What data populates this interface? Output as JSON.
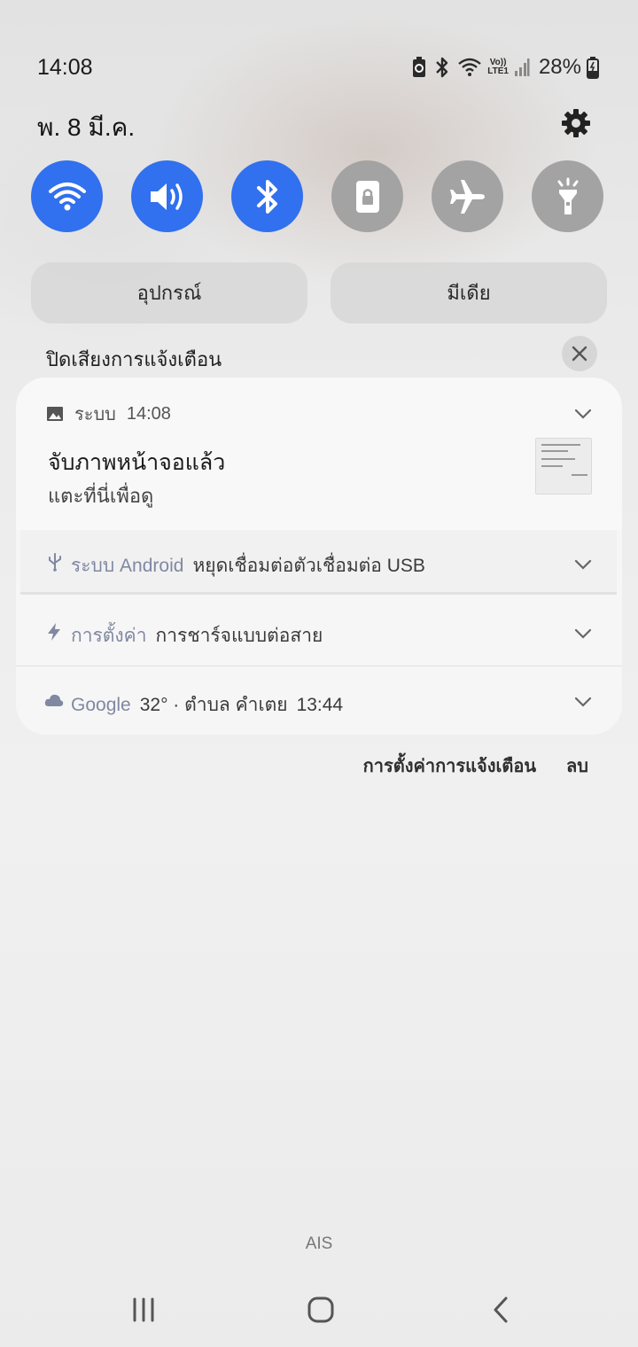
{
  "status": {
    "time": "14:08",
    "battery": "28%",
    "icons": [
      "battery-saver-icon",
      "bluetooth-icon",
      "wifi-icon",
      "volte-lte-icon",
      "signal-icon",
      "battery-charging-icon"
    ],
    "volte_top": "Vo))",
    "volte_bottom": "LTE1"
  },
  "header": {
    "date": "พ. 8 มี.ค.",
    "settings_icon": "gear-icon"
  },
  "quick_toggles": [
    {
      "name": "wifi",
      "icon": "wifi-icon",
      "state": "on"
    },
    {
      "name": "sound",
      "icon": "speaker-icon",
      "state": "on"
    },
    {
      "name": "bluetooth",
      "icon": "bluetooth-icon",
      "state": "on"
    },
    {
      "name": "rotation-lock",
      "icon": "lock-screen-icon",
      "state": "off"
    },
    {
      "name": "airplane",
      "icon": "airplane-icon",
      "state": "off"
    },
    {
      "name": "flashlight",
      "icon": "flashlight-icon",
      "state": "off"
    }
  ],
  "panels": {
    "devices": "อุปกรณ์",
    "media": "มีเดีย"
  },
  "mute_notifications": {
    "label": "ปิดเสียงการแจ้งเตือน"
  },
  "notifications": [
    {
      "app": "ระบบ",
      "time": "14:08",
      "title": "จับภาพหน้าจอแล้ว",
      "subtitle": "แตะที่นี่เพื่อดู",
      "icon": "image-icon"
    },
    {
      "app": "ระบบ Android",
      "message": "หยุดเชื่อมต่อตัวเชื่อมต่อ USB",
      "icon": "usb-icon"
    },
    {
      "app": "การตั้งค่า",
      "message": "การชาร์จแบบต่อสาย",
      "icon": "lightning-icon"
    },
    {
      "app": "Google",
      "message": "32° · ตำบล คำเตย",
      "time": "13:44",
      "icon": "cloud-icon"
    }
  ],
  "actions": {
    "settings": "การตั้งค่าการแจ้งเตือน",
    "clear": "ลบ"
  },
  "carrier": "AIS",
  "colors": {
    "toggle_on": "#3170ee",
    "toggle_off": "#a3a3a3",
    "app_label": "#8088a2"
  }
}
